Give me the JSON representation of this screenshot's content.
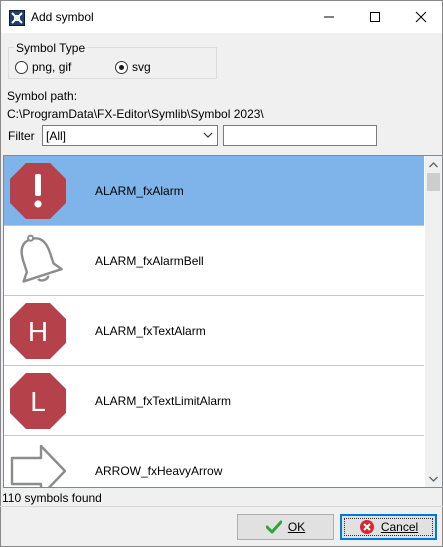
{
  "window": {
    "title": "Add symbol",
    "icon": "app-x-icon"
  },
  "symbol_type": {
    "legend": "Symbol Type",
    "options": [
      {
        "label": "png, gif",
        "selected": false
      },
      {
        "label": "svg",
        "selected": true
      }
    ]
  },
  "path": {
    "label": "Symbol path:",
    "value": "C:\\ProgramData\\FX-Editor\\Symlib\\Symbol 2023\\"
  },
  "filter": {
    "label": "Filter",
    "selected": "[All]",
    "text_value": ""
  },
  "symbols": [
    {
      "name": "ALARM_fxAlarm",
      "icon": "exclamation-octagon-icon",
      "selected": true
    },
    {
      "name": "ALARM_fxAlarmBell",
      "icon": "bell-icon",
      "selected": false
    },
    {
      "name": "ALARM_fxTextAlarm",
      "icon": "h-octagon-icon",
      "glyph": "H",
      "selected": false
    },
    {
      "name": "ALARM_fxTextLimitAlarm",
      "icon": "l-octagon-icon",
      "glyph": "L",
      "selected": false
    },
    {
      "name": "ARROW_fxHeavyArrow",
      "icon": "heavy-arrow-icon",
      "selected": false
    }
  ],
  "status": "110 symbols found",
  "buttons": {
    "ok": "OK",
    "cancel": "Cancel"
  },
  "colors": {
    "selection": "#7eb4ea",
    "alarm_red": "#b5414b",
    "focus_blue": "#0078d7"
  }
}
